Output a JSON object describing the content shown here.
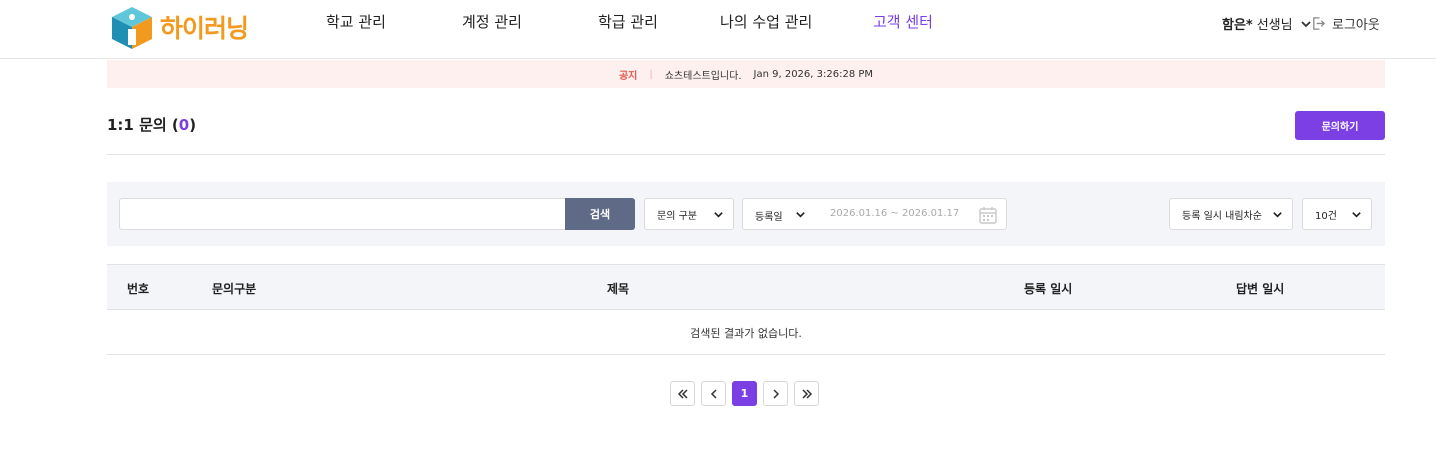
{
  "header": {
    "logo_text": "하이러닝",
    "nav": [
      {
        "label": "학교 관리"
      },
      {
        "label": "계정 관리"
      },
      {
        "label": "학급 관리"
      },
      {
        "label": "나의 수업 관리"
      },
      {
        "label": "고객 센터",
        "active": true
      }
    ],
    "user_name": "함은*",
    "user_role": "선생님",
    "logout_label": "로그아웃"
  },
  "notice": {
    "tag": "공지",
    "text": "쇼츠테스트입니다.",
    "date": "Jan 9, 2026, 3:26:28 PM"
  },
  "page": {
    "title_prefix": "1:1 문의 (",
    "count": "0",
    "title_suffix": ")",
    "ask_button": "문의하기"
  },
  "filter": {
    "search_value": "",
    "search_button": "검색",
    "category_select": "문의 구분",
    "date_type": "등록일",
    "date_range": "2026.01.16 ~ 2026.01.17",
    "sort_select": "등록 일시 내림차순",
    "page_size_select": "10건"
  },
  "table": {
    "columns": [
      "번호",
      "문의구분",
      "제목",
      "등록 일시",
      "답변 일시"
    ],
    "empty_message": "검색된 결과가 없습니다."
  },
  "pagination": {
    "pages": [
      "1"
    ],
    "current": "1"
  },
  "colors": {
    "accent": "#7b3fe4",
    "logo": "#f29a1f",
    "notice_bg": "#fdf0ee",
    "notice_tag": "#e55a4f",
    "search_button": "#5f6a86"
  }
}
